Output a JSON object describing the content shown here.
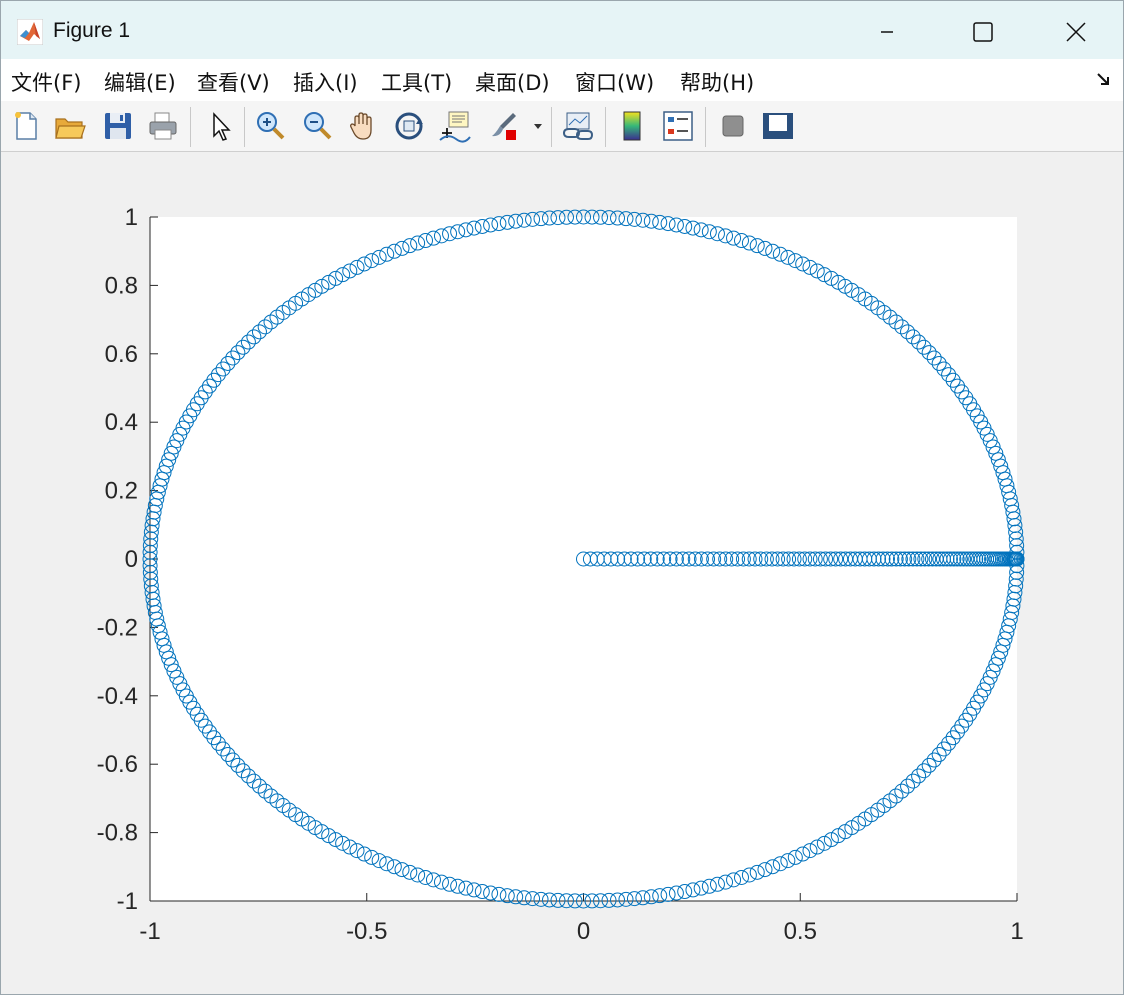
{
  "window": {
    "title": "Figure 1",
    "icon": "matlab-logo-icon"
  },
  "menu": [
    {
      "label": "文件(F)"
    },
    {
      "label": "编辑(E)"
    },
    {
      "label": "查看(V)"
    },
    {
      "label": "插入(I)"
    },
    {
      "label": "工具(T)"
    },
    {
      "label": "桌面(D)"
    },
    {
      "label": "窗口(W)"
    },
    {
      "label": "帮助(H)"
    }
  ],
  "toolbar": [
    {
      "icon": "new-figure-icon"
    },
    {
      "icon": "open-file-icon"
    },
    {
      "icon": "save-icon"
    },
    {
      "icon": "print-icon"
    },
    {
      "icon": "edit-plot-arrow-icon"
    },
    {
      "icon": "zoom-in-icon"
    },
    {
      "icon": "zoom-out-icon"
    },
    {
      "icon": "pan-hand-icon"
    },
    {
      "icon": "rotate-3d-icon"
    },
    {
      "icon": "data-cursor-icon"
    },
    {
      "icon": "brush-icon"
    },
    {
      "icon": "link-plot-icon"
    },
    {
      "icon": "colorbar-icon"
    },
    {
      "icon": "legend-icon"
    },
    {
      "icon": "hide-plot-tools-icon"
    },
    {
      "icon": "show-plot-tools-icon"
    }
  ],
  "colors": {
    "marker": "#0072BD",
    "titlebar": "#e6f4f6",
    "axes_bg": "#ffffff"
  },
  "chart_data": {
    "type": "scatter",
    "marker": "circle-open",
    "xlim": [
      -1,
      1
    ],
    "ylim": [
      -1,
      1
    ],
    "x_ticks": [
      "-1",
      "-0.5",
      "0",
      "0.5",
      "1"
    ],
    "y_ticks": [
      "-1",
      "-0.8",
      "-0.6",
      "-0.4",
      "-0.2",
      "0",
      "0.2",
      "0.4",
      "0.6",
      "0.8",
      "1"
    ],
    "series": [
      {
        "label": "unit circle points",
        "parametric": "x = cos(t), y = sin(t), t in [0, 2π]",
        "count": 320
      },
      {
        "label": "segment points along y = 0",
        "x_range": [
          0,
          1
        ],
        "y": 0,
        "count": 100
      }
    ],
    "grid": false
  }
}
